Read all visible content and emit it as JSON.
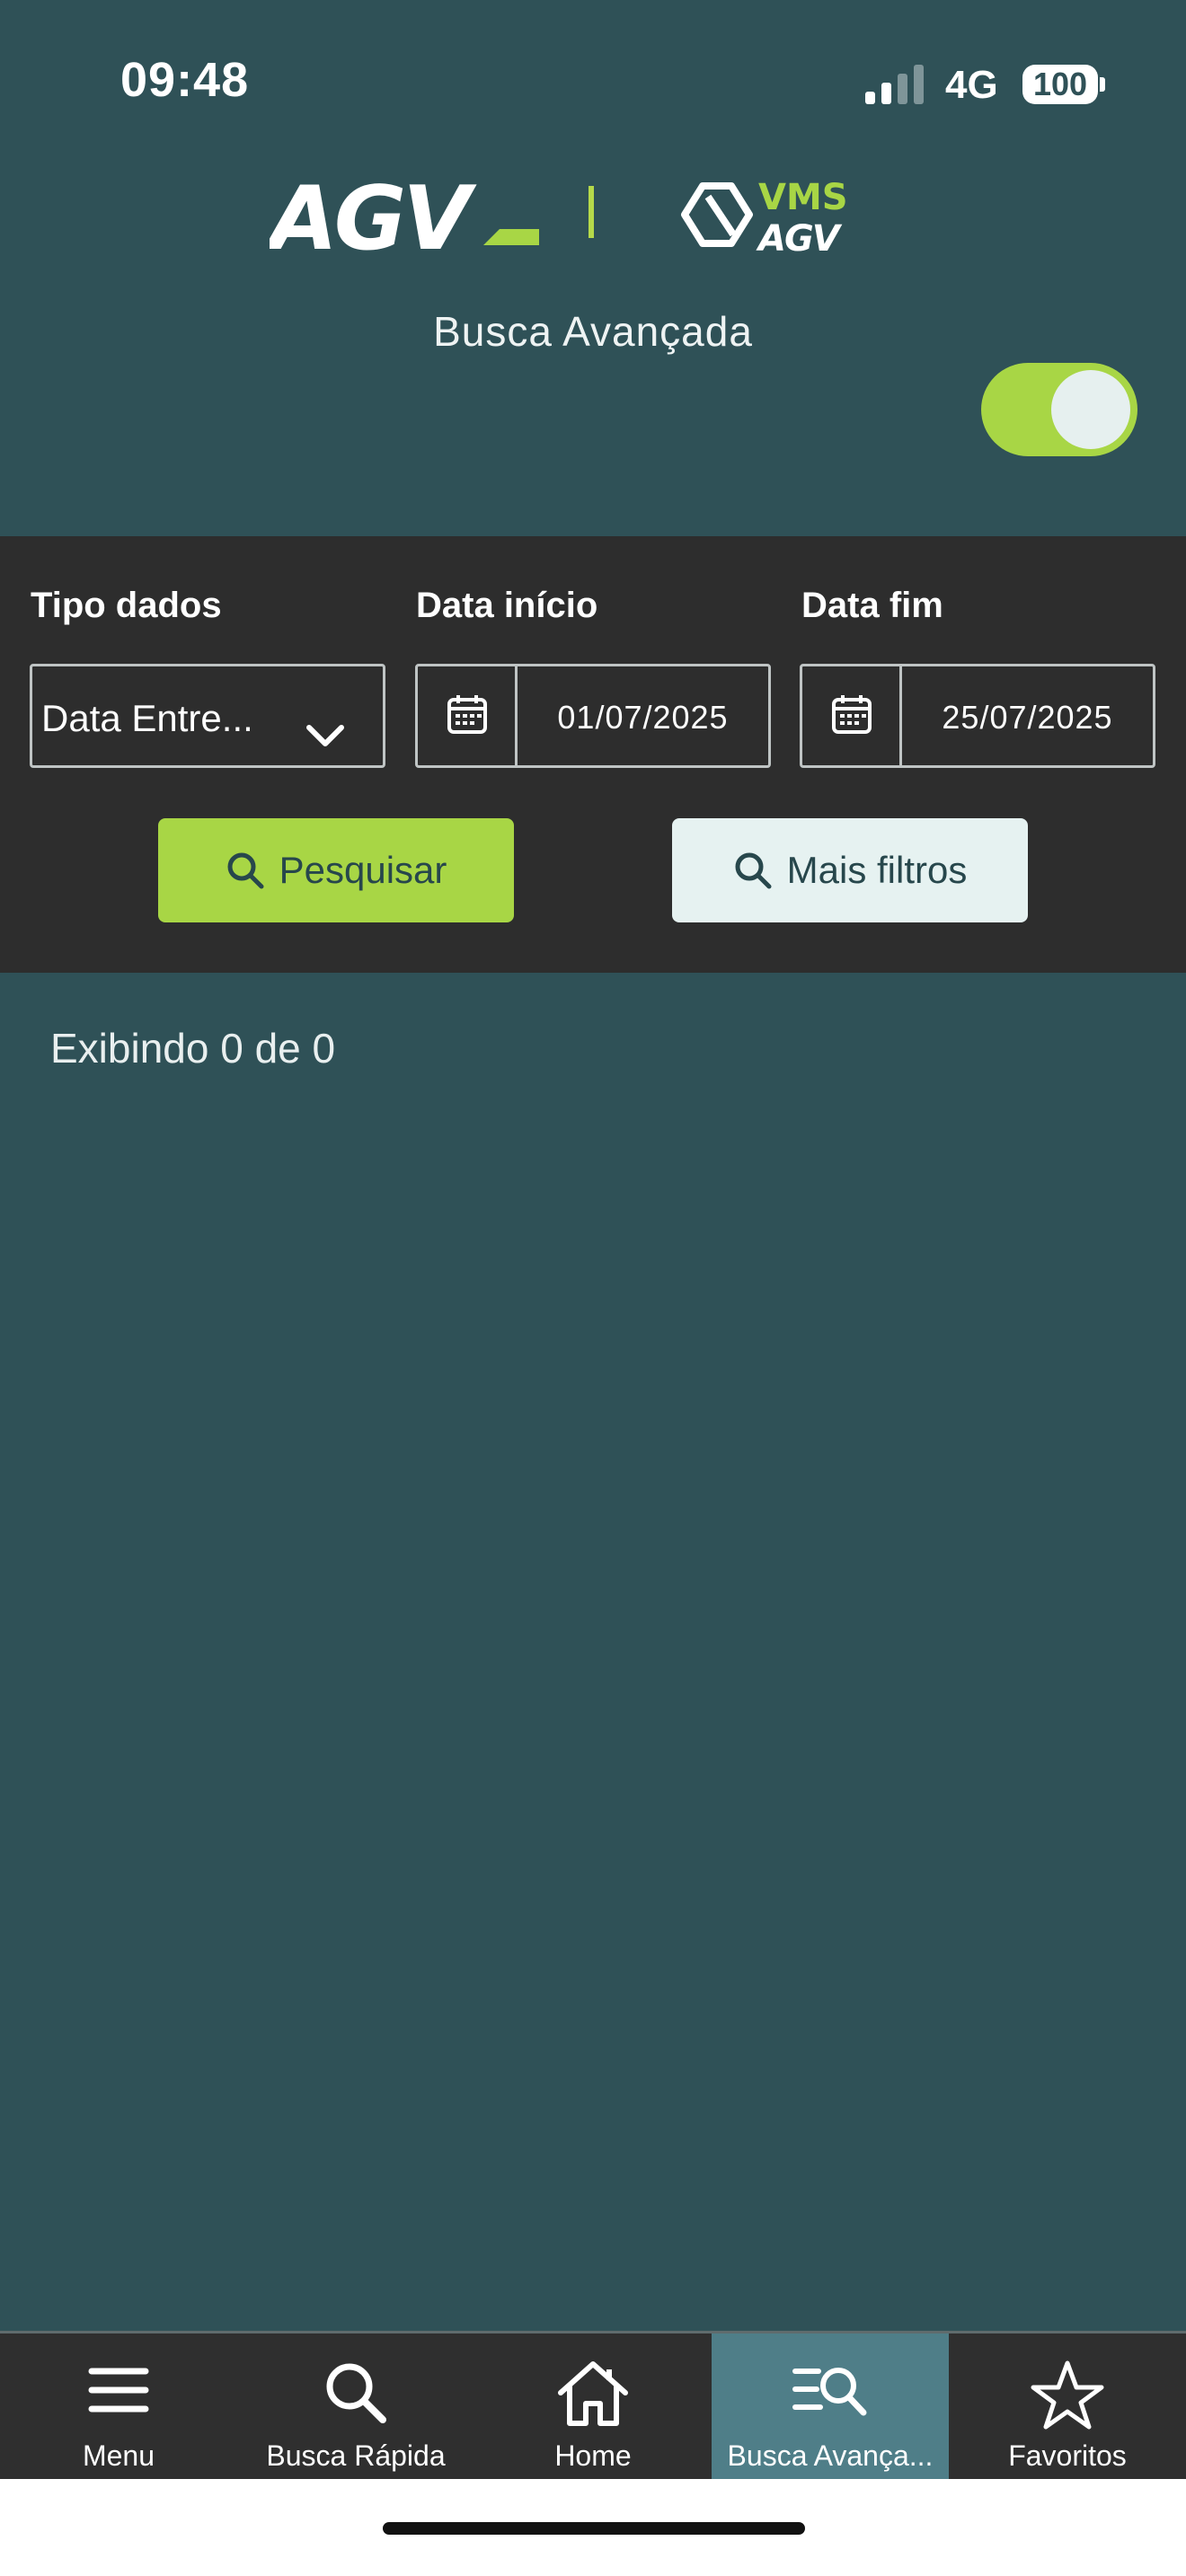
{
  "status_bar": {
    "time": "09:48",
    "network": "4G",
    "battery": "100"
  },
  "header": {
    "logo_primary": "AGV",
    "logo_secondary_top": "VMS",
    "logo_secondary_bottom": "AGV",
    "title": "Busca Avançada",
    "toggle_on": true,
    "accent_color": "#a8d645"
  },
  "filters": {
    "type_label": "Tipo dados",
    "type_value": "Data Entre...",
    "start_label": "Data início",
    "start_value": "01/07/2025",
    "end_label": "Data fim",
    "end_value": "25/07/2025",
    "search_button": "Pesquisar",
    "more_filters_button": "Mais filtros"
  },
  "results": {
    "summary": "Exibindo 0 de 0"
  },
  "bottom_nav": {
    "items": [
      {
        "label": "Menu",
        "icon": "hamburger-icon"
      },
      {
        "label": "Busca Rápida",
        "icon": "search-icon"
      },
      {
        "label": "Home",
        "icon": "home-icon"
      },
      {
        "label": "Busca Avança...",
        "icon": "advanced-search-icon",
        "active": true
      },
      {
        "label": "Favoritos",
        "icon": "star-icon"
      }
    ]
  }
}
